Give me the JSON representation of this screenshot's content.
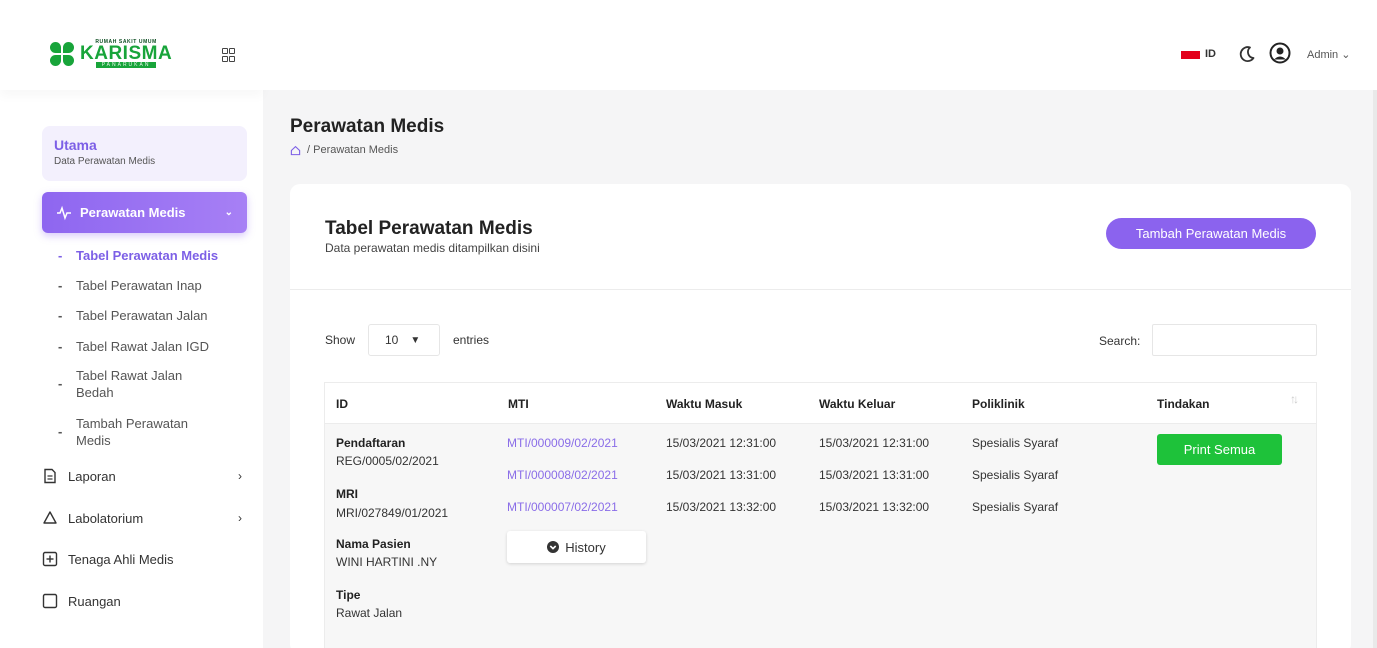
{
  "logo": {
    "top_text": "RUMAH SAKIT UMUM",
    "name": "KARISMA",
    "sub_text": "PANARUKAN"
  },
  "sidebar": {
    "utama": {
      "title": "Utama",
      "subtitle": "Data Perawatan Medis"
    },
    "active_menu": {
      "label": "Perawatan Medis"
    },
    "sub_items": [
      {
        "label": "Tabel Perawatan Medis"
      },
      {
        "label": "Tabel Perawatan Inap"
      },
      {
        "label": "Tabel Perawatan Jalan"
      },
      {
        "label": "Tabel Rawat Jalan IGD"
      },
      {
        "label": "Tabel Rawat Jalan Bedah"
      },
      {
        "label": "Tambah Perawatan Medis"
      }
    ],
    "menu_items": [
      {
        "label": "Laporan",
        "icon": "document-icon"
      },
      {
        "label": "Labolatorium",
        "icon": "flask-icon"
      },
      {
        "label": "Tenaga Ahli Medis",
        "icon": "plus-square-icon"
      },
      {
        "label": "Ruangan",
        "icon": "square-icon"
      }
    ]
  },
  "header": {
    "language": "ID",
    "user": "Admin",
    "colors": {
      "flag": "#e3001b"
    }
  },
  "page": {
    "title": "Perawatan Medis",
    "breadcrumb": "Perawatan Medis"
  },
  "card": {
    "title": "Tabel Perawatan Medis",
    "subtitle": "Data perawatan medis ditampilkan disini",
    "add_button": "Tambah Perawatan Medis"
  },
  "table_controls": {
    "show_label": "Show",
    "entries_value": "10",
    "entries_label": "entries",
    "search_label": "Search:",
    "search_value": ""
  },
  "table": {
    "headers": [
      "ID",
      "MTI",
      "Waktu Masuk",
      "Waktu Keluar",
      "Poliklinik",
      "Tindakan"
    ],
    "patient": {
      "pendaftaran_label": "Pendaftaran",
      "pendaftaran_value": "REG/0005/02/2021",
      "mri_label": "MRI",
      "mri_value": "MRI/027849/01/2021",
      "nama_label": "Nama Pasien",
      "nama_value": "WINI HARTINI .NY",
      "tipe_label": "Tipe",
      "tipe_value": "Rawat Jalan"
    },
    "records": [
      {
        "mti": "MTI/000009/02/2021",
        "masuk": "15/03/2021 12:31:00",
        "keluar": "15/03/2021 12:31:00",
        "poli": "Spesialis Syaraf"
      },
      {
        "mti": "MTI/000008/02/2021",
        "masuk": "15/03/2021 13:31:00",
        "keluar": "15/03/2021 13:31:00",
        "poli": "Spesialis Syaraf"
      },
      {
        "mti": "MTI/000007/02/2021",
        "masuk": "15/03/2021 13:32:00",
        "keluar": "15/03/2021 13:32:00",
        "poli": "Spesialis Syaraf"
      }
    ],
    "history_button": "History",
    "print_button": "Print Semua"
  },
  "colors": {
    "accent": "#8b63ee",
    "success": "#1ec23a",
    "brand_green": "#18a43a"
  }
}
